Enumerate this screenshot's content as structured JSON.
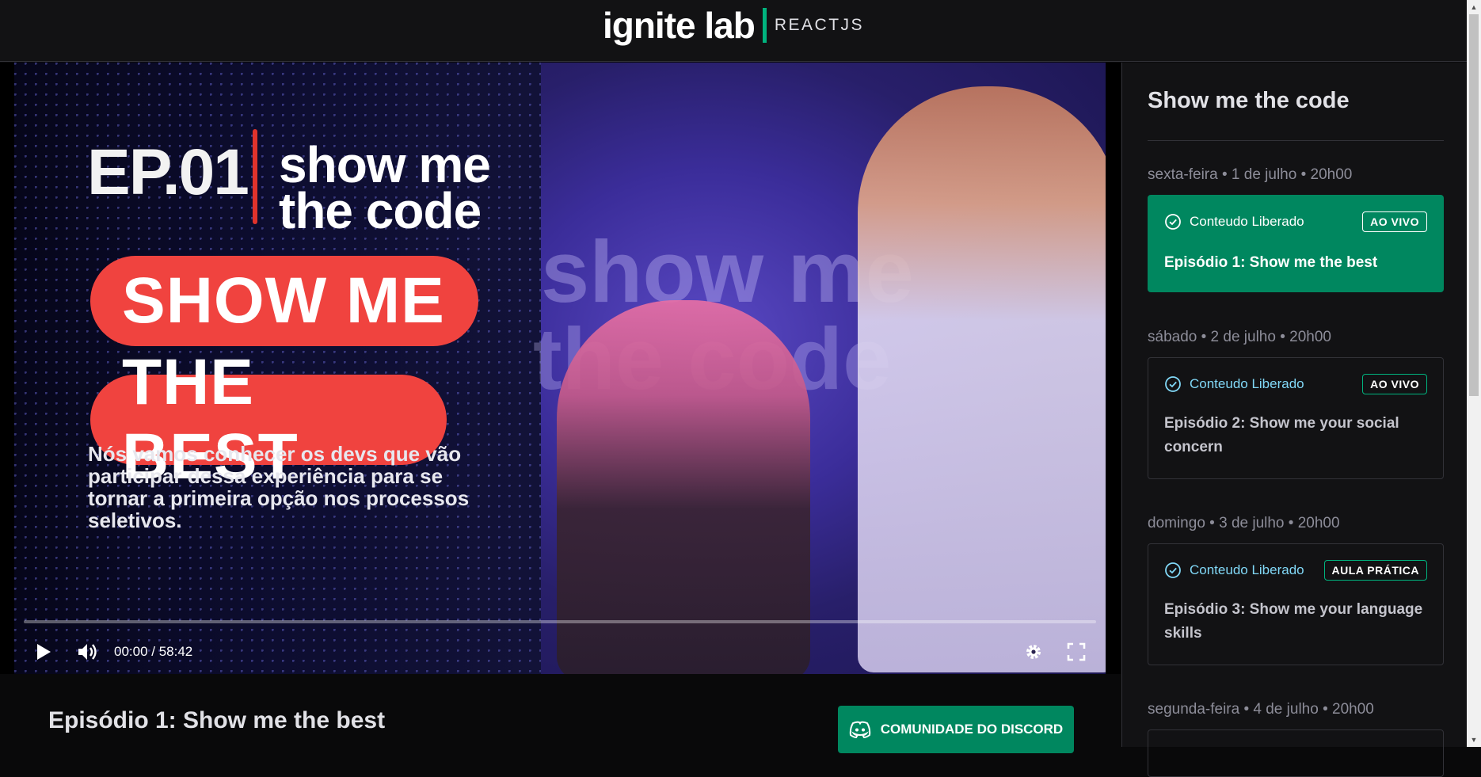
{
  "header": {
    "logo_text": "ignite lab",
    "logo_sub": "REACTJS"
  },
  "video": {
    "ep_number": "EP.01",
    "brand_line1": "show me",
    "brand_line2": "the code",
    "headline_1": "SHOW ME",
    "headline_2": "THE BEST",
    "description": "Nós vamos conhecer os devs que vão participar dessa experiência para se tornar a primeira opção nos processos seletivos.",
    "background_text_1": "show me",
    "background_text_2": "the code",
    "time": "00:00 / 58:42",
    "progress": 0
  },
  "lesson_main": {
    "title": "Episódio 1: Show me the best",
    "discord_label": "COMUNIDADE DO DISCORD"
  },
  "sidebar": {
    "title": "Show me the code",
    "lessons": [
      {
        "date": "sexta-feira • 1 de julho • 20h00",
        "status": "Conteudo Liberado",
        "badge": "AO VIVO",
        "title": "Episódio 1: Show me the best",
        "active": true
      },
      {
        "date": "sábado • 2 de julho • 20h00",
        "status": "Conteudo Liberado",
        "badge": "AO VIVO",
        "title": "Episódio 2: Show me your social concern",
        "active": false
      },
      {
        "date": "domingo • 3 de julho • 20h00",
        "status": "Conteudo Liberado",
        "badge": "AULA PRÁTICA",
        "title": "Episódio 3: Show me your language skills",
        "active": false
      },
      {
        "date": "segunda-feira • 4 de julho • 20h00"
      }
    ]
  },
  "colors": {
    "accent_green": "#00875f",
    "bright_green": "#00b37e",
    "status_blue": "#81d8f7",
    "pill_red": "#f0433f"
  }
}
